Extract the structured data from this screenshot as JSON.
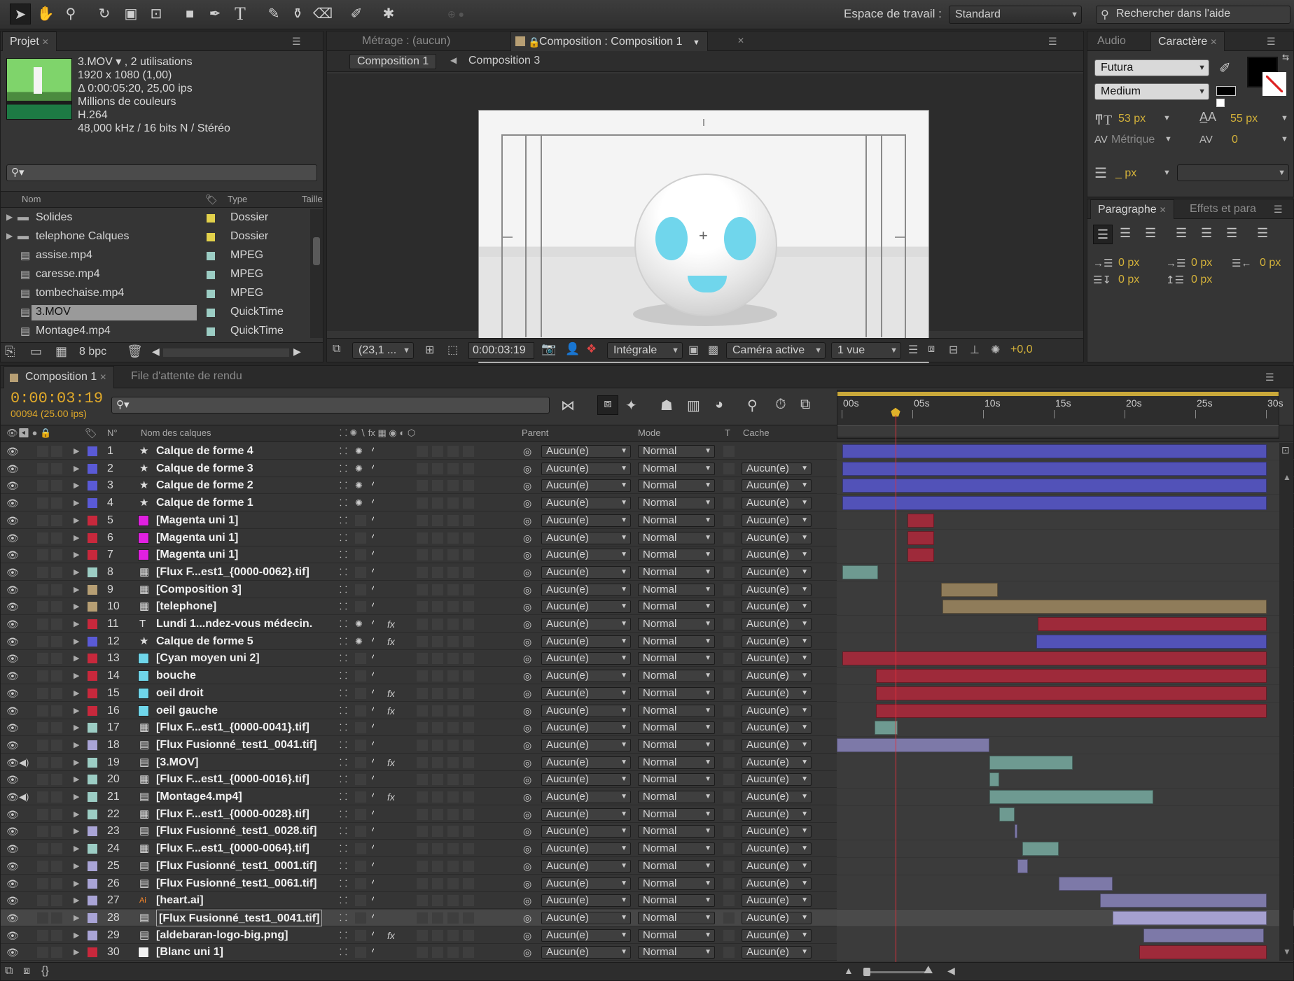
{
  "toolbar": {
    "workspace_label": "Espace de travail :",
    "workspace_value": "Standard",
    "search_help": "Rechercher dans l'aide",
    "tools": [
      "selection-icon",
      "hand-icon",
      "zoom-icon",
      "rotate-icon",
      "camera-orbit-icon",
      "pan-behind-icon",
      "rectangle-icon",
      "pen-icon",
      "type-icon",
      "brush-icon",
      "clone-stamp-icon",
      "eraser-icon",
      "roto-brush-icon",
      "puppet-pin-icon"
    ]
  },
  "project": {
    "tab": "Projet",
    "file_name": "3.MOV ▾ , 2 utilisations",
    "info": [
      "1920 x 1080 (1,00)",
      "Δ 0:00:05:20, 25,00 ips",
      "Millions de couleurs",
      "H.264",
      "48,000 kHz / 16 bits N / Stéréo"
    ],
    "col_name": "Nom",
    "col_type": "Type",
    "col_size": "Taille",
    "items": [
      {
        "name": "Solides",
        "type": "Dossier",
        "color": "#e2d14b",
        "kind": "folder"
      },
      {
        "name": "telephone Calques",
        "type": "Dossier",
        "color": "#e2d14b",
        "kind": "folder"
      },
      {
        "name": "assise.mp4",
        "type": "MPEG",
        "color": "#9ccdc4",
        "kind": "file"
      },
      {
        "name": "caresse.mp4",
        "type": "MPEG",
        "color": "#9ccdc4",
        "kind": "file"
      },
      {
        "name": "tombechaise.mp4",
        "type": "MPEG",
        "color": "#9ccdc4",
        "kind": "file"
      },
      {
        "name": "3.MOV",
        "type": "QuickTime",
        "color": "#9ccdc4",
        "kind": "file"
      },
      {
        "name": "Montage4.mp4",
        "type": "QuickTime",
        "color": "#9ccdc4",
        "kind": "file"
      }
    ],
    "bpc": "8 bpc"
  },
  "viewer": {
    "tab_footage": "Métrage : (aucun)",
    "tab_comp": "Composition : Composition 1",
    "crumb1": "Composition 1",
    "crumb2": "Composition 3",
    "zoom": "(23,1 ...",
    "timecode": "0:00:03:19",
    "resolution": "Intégrale",
    "camera": "Caméra active",
    "views": "1 vue",
    "exposure": "+0,0"
  },
  "character": {
    "tab_audio": "Audio",
    "tab_char": "Caractère",
    "font": "Futura",
    "style": "Medium",
    "size": "53 px",
    "leading": "55 px",
    "kerning": "Métrique",
    "tracking": "0",
    "stroke": "_ px",
    "fill_color": "#000000"
  },
  "paragraph": {
    "tab_para": "Paragraphe",
    "tab_effects": "Effets et para",
    "indent1": "0 px",
    "indent2": "0 px",
    "indent3": "0 px",
    "space1": "0 px",
    "space2": "0 px"
  },
  "timeline": {
    "tab_comp": "Composition 1",
    "tab_render": "File d'attente de rendu",
    "timecode": "0:00:03:19",
    "frame": "00094 (25.00 ips)",
    "col_num": "N°",
    "col_name": "Nom des calques",
    "col_parent": "Parent",
    "col_mode": "Mode",
    "col_t": "T",
    "col_cache": "Cache",
    "ruler": [
      "00s",
      "05s",
      "10s",
      "15s",
      "20s",
      "25s",
      "30s"
    ],
    "current_time_s": 3.76,
    "duration_s": 30,
    "layers": [
      {
        "n": "1",
        "name": "Calque de forme 4",
        "label": "#5a5ad6",
        "icon": "★",
        "swatch": "",
        "fx": false,
        "sun": true,
        "parent": "Aucun(e)",
        "mode": "Normal",
        "cache": "",
        "bars": [
          {
            "s": 0,
            "e": 30,
            "c": "#5252b8"
          }
        ]
      },
      {
        "n": "2",
        "name": "Calque de forme 3",
        "label": "#5a5ad6",
        "icon": "★",
        "swatch": "",
        "fx": false,
        "sun": true,
        "parent": "Aucun(e)",
        "mode": "Normal",
        "cache": "Aucun(e)",
        "bars": [
          {
            "s": 0,
            "e": 30,
            "c": "#5252b8"
          }
        ]
      },
      {
        "n": "3",
        "name": "Calque de forme 2",
        "label": "#5a5ad6",
        "icon": "★",
        "swatch": "",
        "fx": false,
        "sun": true,
        "parent": "Aucun(e)",
        "mode": "Normal",
        "cache": "Aucun(e)",
        "bars": [
          {
            "s": 0,
            "e": 30,
            "c": "#5252b8"
          }
        ]
      },
      {
        "n": "4",
        "name": "Calque de forme 1",
        "label": "#5a5ad6",
        "icon": "★",
        "swatch": "",
        "fx": false,
        "sun": true,
        "parent": "Aucun(e)",
        "mode": "Normal",
        "cache": "Aucun(e)",
        "bars": [
          {
            "s": 0,
            "e": 30,
            "c": "#5252b8"
          }
        ]
      },
      {
        "n": "5",
        "name": "[Magenta uni 1]",
        "label": "#c8283c",
        "icon": "",
        "swatch": "#e020e0",
        "fx": false,
        "sun": false,
        "parent": "Aucun(e)",
        "mode": "Normal",
        "cache": "Aucun(e)",
        "bars": [
          {
            "s": 4.6,
            "e": 6.5,
            "c": "#9e2a3a"
          }
        ]
      },
      {
        "n": "6",
        "name": "[Magenta uni 1]",
        "label": "#c8283c",
        "icon": "",
        "swatch": "#e020e0",
        "fx": false,
        "sun": false,
        "parent": "Aucun(e)",
        "mode": "Normal",
        "cache": "Aucun(e)",
        "bars": [
          {
            "s": 4.6,
            "e": 6.5,
            "c": "#9e2a3a"
          }
        ]
      },
      {
        "n": "7",
        "name": "[Magenta uni 1]",
        "label": "#c8283c",
        "icon": "",
        "swatch": "#e020e0",
        "fx": false,
        "sun": false,
        "parent": "Aucun(e)",
        "mode": "Normal",
        "cache": "Aucun(e)",
        "bars": [
          {
            "s": 4.6,
            "e": 6.5,
            "c": "#9e2a3a"
          }
        ]
      },
      {
        "n": "8",
        "name": "[Flux F...est1_{0000-0062}.tif]",
        "label": "#9ccdc4",
        "icon": "▦",
        "swatch": "",
        "fx": false,
        "sun": false,
        "parent": "Aucun(e)",
        "mode": "Normal",
        "cache": "Aucun(e)",
        "bars": [
          {
            "s": 0,
            "e": 2.5,
            "c": "#6e9a91"
          }
        ]
      },
      {
        "n": "9",
        "name": "[Composition 3]",
        "label": "#b79f74",
        "icon": "▦",
        "swatch": "",
        "fx": false,
        "sun": false,
        "parent": "Aucun(e)",
        "mode": "Normal",
        "cache": "Aucun(e)",
        "bars": [
          {
            "s": 7,
            "e": 11,
            "c": "#8f7c5a"
          }
        ]
      },
      {
        "n": "10",
        "name": "[telephone]",
        "label": "#b79f74",
        "icon": "▦",
        "swatch": "",
        "fx": false,
        "sun": false,
        "parent": "Aucun(e)",
        "mode": "Normal",
        "cache": "Aucun(e)",
        "bars": [
          {
            "s": 7.1,
            "e": 30,
            "c": "#8f7c5a"
          }
        ]
      },
      {
        "n": "11",
        "name": "Lundi 1...ndez-vous médecin.",
        "label": "#c8283c",
        "icon": "T",
        "swatch": "",
        "fx": true,
        "sun": true,
        "parent": "Aucun(e)",
        "mode": "Normal",
        "cache": "Aucun(e)",
        "bars": [
          {
            "s": 13.8,
            "e": 30,
            "c": "#9e2a3a"
          }
        ]
      },
      {
        "n": "12",
        "name": "Calque de forme 5",
        "label": "#5a5ad6",
        "icon": "★",
        "swatch": "",
        "fx": true,
        "sun": true,
        "parent": "Aucun(e)",
        "mode": "Normal",
        "cache": "Aucun(e)",
        "bars": [
          {
            "s": 13.7,
            "e": 30,
            "c": "#5252b8"
          }
        ]
      },
      {
        "n": "13",
        "name": "[Cyan moyen uni 2]",
        "label": "#c8283c",
        "icon": "",
        "swatch": "#6fd6ea",
        "fx": false,
        "sun": false,
        "parent": "Aucun(e)",
        "mode": "Normal",
        "cache": "Aucun(e)",
        "bars": [
          {
            "s": 0,
            "e": 30,
            "c": "#9e2a3a"
          }
        ]
      },
      {
        "n": "14",
        "name": "bouche",
        "label": "#c8283c",
        "icon": "",
        "swatch": "#6fd6ea",
        "fx": false,
        "sun": false,
        "parent": "Aucun(e)",
        "mode": "Normal",
        "cache": "Aucun(e)",
        "bars": [
          {
            "s": 2.4,
            "e": 30,
            "c": "#9e2a3a"
          }
        ]
      },
      {
        "n": "15",
        "name": "oeil droit",
        "label": "#c8283c",
        "icon": "",
        "swatch": "#6fd6ea",
        "fx": true,
        "sun": false,
        "parent": "Aucun(e)",
        "mode": "Normal",
        "cache": "Aucun(e)",
        "bars": [
          {
            "s": 2.4,
            "e": 30,
            "c": "#9e2a3a"
          }
        ]
      },
      {
        "n": "16",
        "name": "oeil gauche",
        "label": "#c8283c",
        "icon": "",
        "swatch": "#6fd6ea",
        "fx": true,
        "sun": false,
        "parent": "Aucun(e)",
        "mode": "Normal",
        "cache": "Aucun(e)",
        "bars": [
          {
            "s": 2.4,
            "e": 30,
            "c": "#9e2a3a"
          }
        ]
      },
      {
        "n": "17",
        "name": "[Flux F...est1_{0000-0041}.tif]",
        "label": "#9ccdc4",
        "icon": "▦",
        "swatch": "",
        "fx": false,
        "sun": false,
        "parent": "Aucun(e)",
        "mode": "Normal",
        "cache": "Aucun(e)",
        "bars": [
          {
            "s": 2.3,
            "e": 3.9,
            "c": "#6e9a91"
          }
        ]
      },
      {
        "n": "18",
        "name": "[Flux Fusionné_test1_0041.tif]",
        "label": "#a9a4d6",
        "icon": "▤",
        "swatch": "",
        "fx": false,
        "sun": false,
        "parent": "Aucun(e)",
        "mode": "Normal",
        "cache": "Aucun(e)",
        "bars": [
          {
            "s": -0.4,
            "e": 10.4,
            "c": "#7d79a8"
          }
        ]
      },
      {
        "n": "19",
        "name": "[3.MOV]",
        "label": "#9ccdc4",
        "icon": "▤",
        "swatch": "",
        "fx": true,
        "sun": false,
        "audio": true,
        "parent": "Aucun(e)",
        "mode": "Normal",
        "cache": "Aucun(e)",
        "bars": [
          {
            "s": 10.4,
            "e": 16.3,
            "c": "#6e9a91"
          }
        ]
      },
      {
        "n": "20",
        "name": "[Flux F...est1_{0000-0016}.tif]",
        "label": "#9ccdc4",
        "icon": "▦",
        "swatch": "",
        "fx": false,
        "sun": false,
        "parent": "Aucun(e)",
        "mode": "Normal",
        "cache": "Aucun(e)",
        "bars": [
          {
            "s": 10.4,
            "e": 11.1,
            "c": "#6e9a91"
          }
        ]
      },
      {
        "n": "21",
        "name": "[Montage4.mp4]",
        "label": "#9ccdc4",
        "icon": "▤",
        "swatch": "",
        "fx": true,
        "sun": false,
        "audio": true,
        "parent": "Aucun(e)",
        "mode": "Normal",
        "cache": "Aucun(e)",
        "bars": [
          {
            "s": 10.4,
            "e": 22,
            "c": "#6e9a91"
          }
        ]
      },
      {
        "n": "22",
        "name": "[Flux F...est1_{0000-0028}.tif]",
        "label": "#9ccdc4",
        "icon": "▦",
        "swatch": "",
        "fx": false,
        "sun": false,
        "parent": "Aucun(e)",
        "mode": "Normal",
        "cache": "Aucun(e)",
        "bars": [
          {
            "s": 11.1,
            "e": 12.2,
            "c": "#6e9a91"
          }
        ]
      },
      {
        "n": "23",
        "name": "[Flux Fusionné_test1_0028.tif]",
        "label": "#a9a4d6",
        "icon": "▤",
        "swatch": "",
        "fx": false,
        "sun": false,
        "parent": "Aucun(e)",
        "mode": "Normal",
        "cache": "Aucun(e)",
        "bars": [
          {
            "s": 12.2,
            "e": 12.4,
            "c": "#7d79a8"
          }
        ]
      },
      {
        "n": "24",
        "name": "[Flux F...est1_{0000-0064}.tif]",
        "label": "#9ccdc4",
        "icon": "▦",
        "swatch": "",
        "fx": false,
        "sun": false,
        "parent": "Aucun(e)",
        "mode": "Normal",
        "cache": "Aucun(e)",
        "bars": [
          {
            "s": 12.7,
            "e": 15.3,
            "c": "#6e9a91"
          }
        ]
      },
      {
        "n": "25",
        "name": "[Flux Fusionné_test1_0001.tif]",
        "label": "#a9a4d6",
        "icon": "▤",
        "swatch": "",
        "fx": false,
        "sun": false,
        "parent": "Aucun(e)",
        "mode": "Normal",
        "cache": "Aucun(e)",
        "bars": [
          {
            "s": 12.4,
            "e": 13.1,
            "c": "#7d79a8"
          }
        ]
      },
      {
        "n": "26",
        "name": "[Flux Fusionné_test1_0061.tif]",
        "label": "#a9a4d6",
        "icon": "▤",
        "swatch": "",
        "fx": false,
        "sun": false,
        "parent": "Aucun(e)",
        "mode": "Normal",
        "cache": "Aucun(e)",
        "bars": [
          {
            "s": 15.3,
            "e": 19.1,
            "c": "#7d79a8"
          }
        ]
      },
      {
        "n": "27",
        "name": "[heart.ai]",
        "label": "#a9a4d6",
        "icon": "Ai",
        "swatch": "",
        "fx": false,
        "sun": false,
        "parent": "Aucun(e)",
        "mode": "Normal",
        "cache": "Aucun(e)",
        "bars": [
          {
            "s": 18.2,
            "e": 30,
            "c": "#7d79a8"
          }
        ]
      },
      {
        "n": "28",
        "name": "[Flux Fusionné_test1_0041.tif]",
        "label": "#a9a4d6",
        "icon": "▤",
        "swatch": "",
        "fx": false,
        "sun": false,
        "parent": "Aucun(e)",
        "mode": "Normal",
        "cache": "Aucun(e)",
        "selected": true,
        "bars": [
          {
            "s": 19.1,
            "e": 30,
            "c": "#a5a0cf"
          }
        ]
      },
      {
        "n": "29",
        "name": "[aldebaran-logo-big.png]",
        "label": "#a9a4d6",
        "icon": "▤",
        "swatch": "",
        "fx": true,
        "sun": false,
        "parent": "Aucun(e)",
        "mode": "Normal",
        "cache": "Aucun(e)",
        "bars": [
          {
            "s": 21.3,
            "e": 29.8,
            "c": "#7d79a8"
          }
        ]
      },
      {
        "n": "30",
        "name": "[Blanc uni 1]",
        "label": "#c8283c",
        "icon": "",
        "swatch": "#f2f2f2",
        "fx": false,
        "sun": false,
        "parent": "Aucun(e)",
        "mode": "Normal",
        "cache": "Aucun(e)",
        "bars": [
          {
            "s": 21,
            "e": 30,
            "c": "#9e2a3a"
          }
        ]
      }
    ]
  }
}
